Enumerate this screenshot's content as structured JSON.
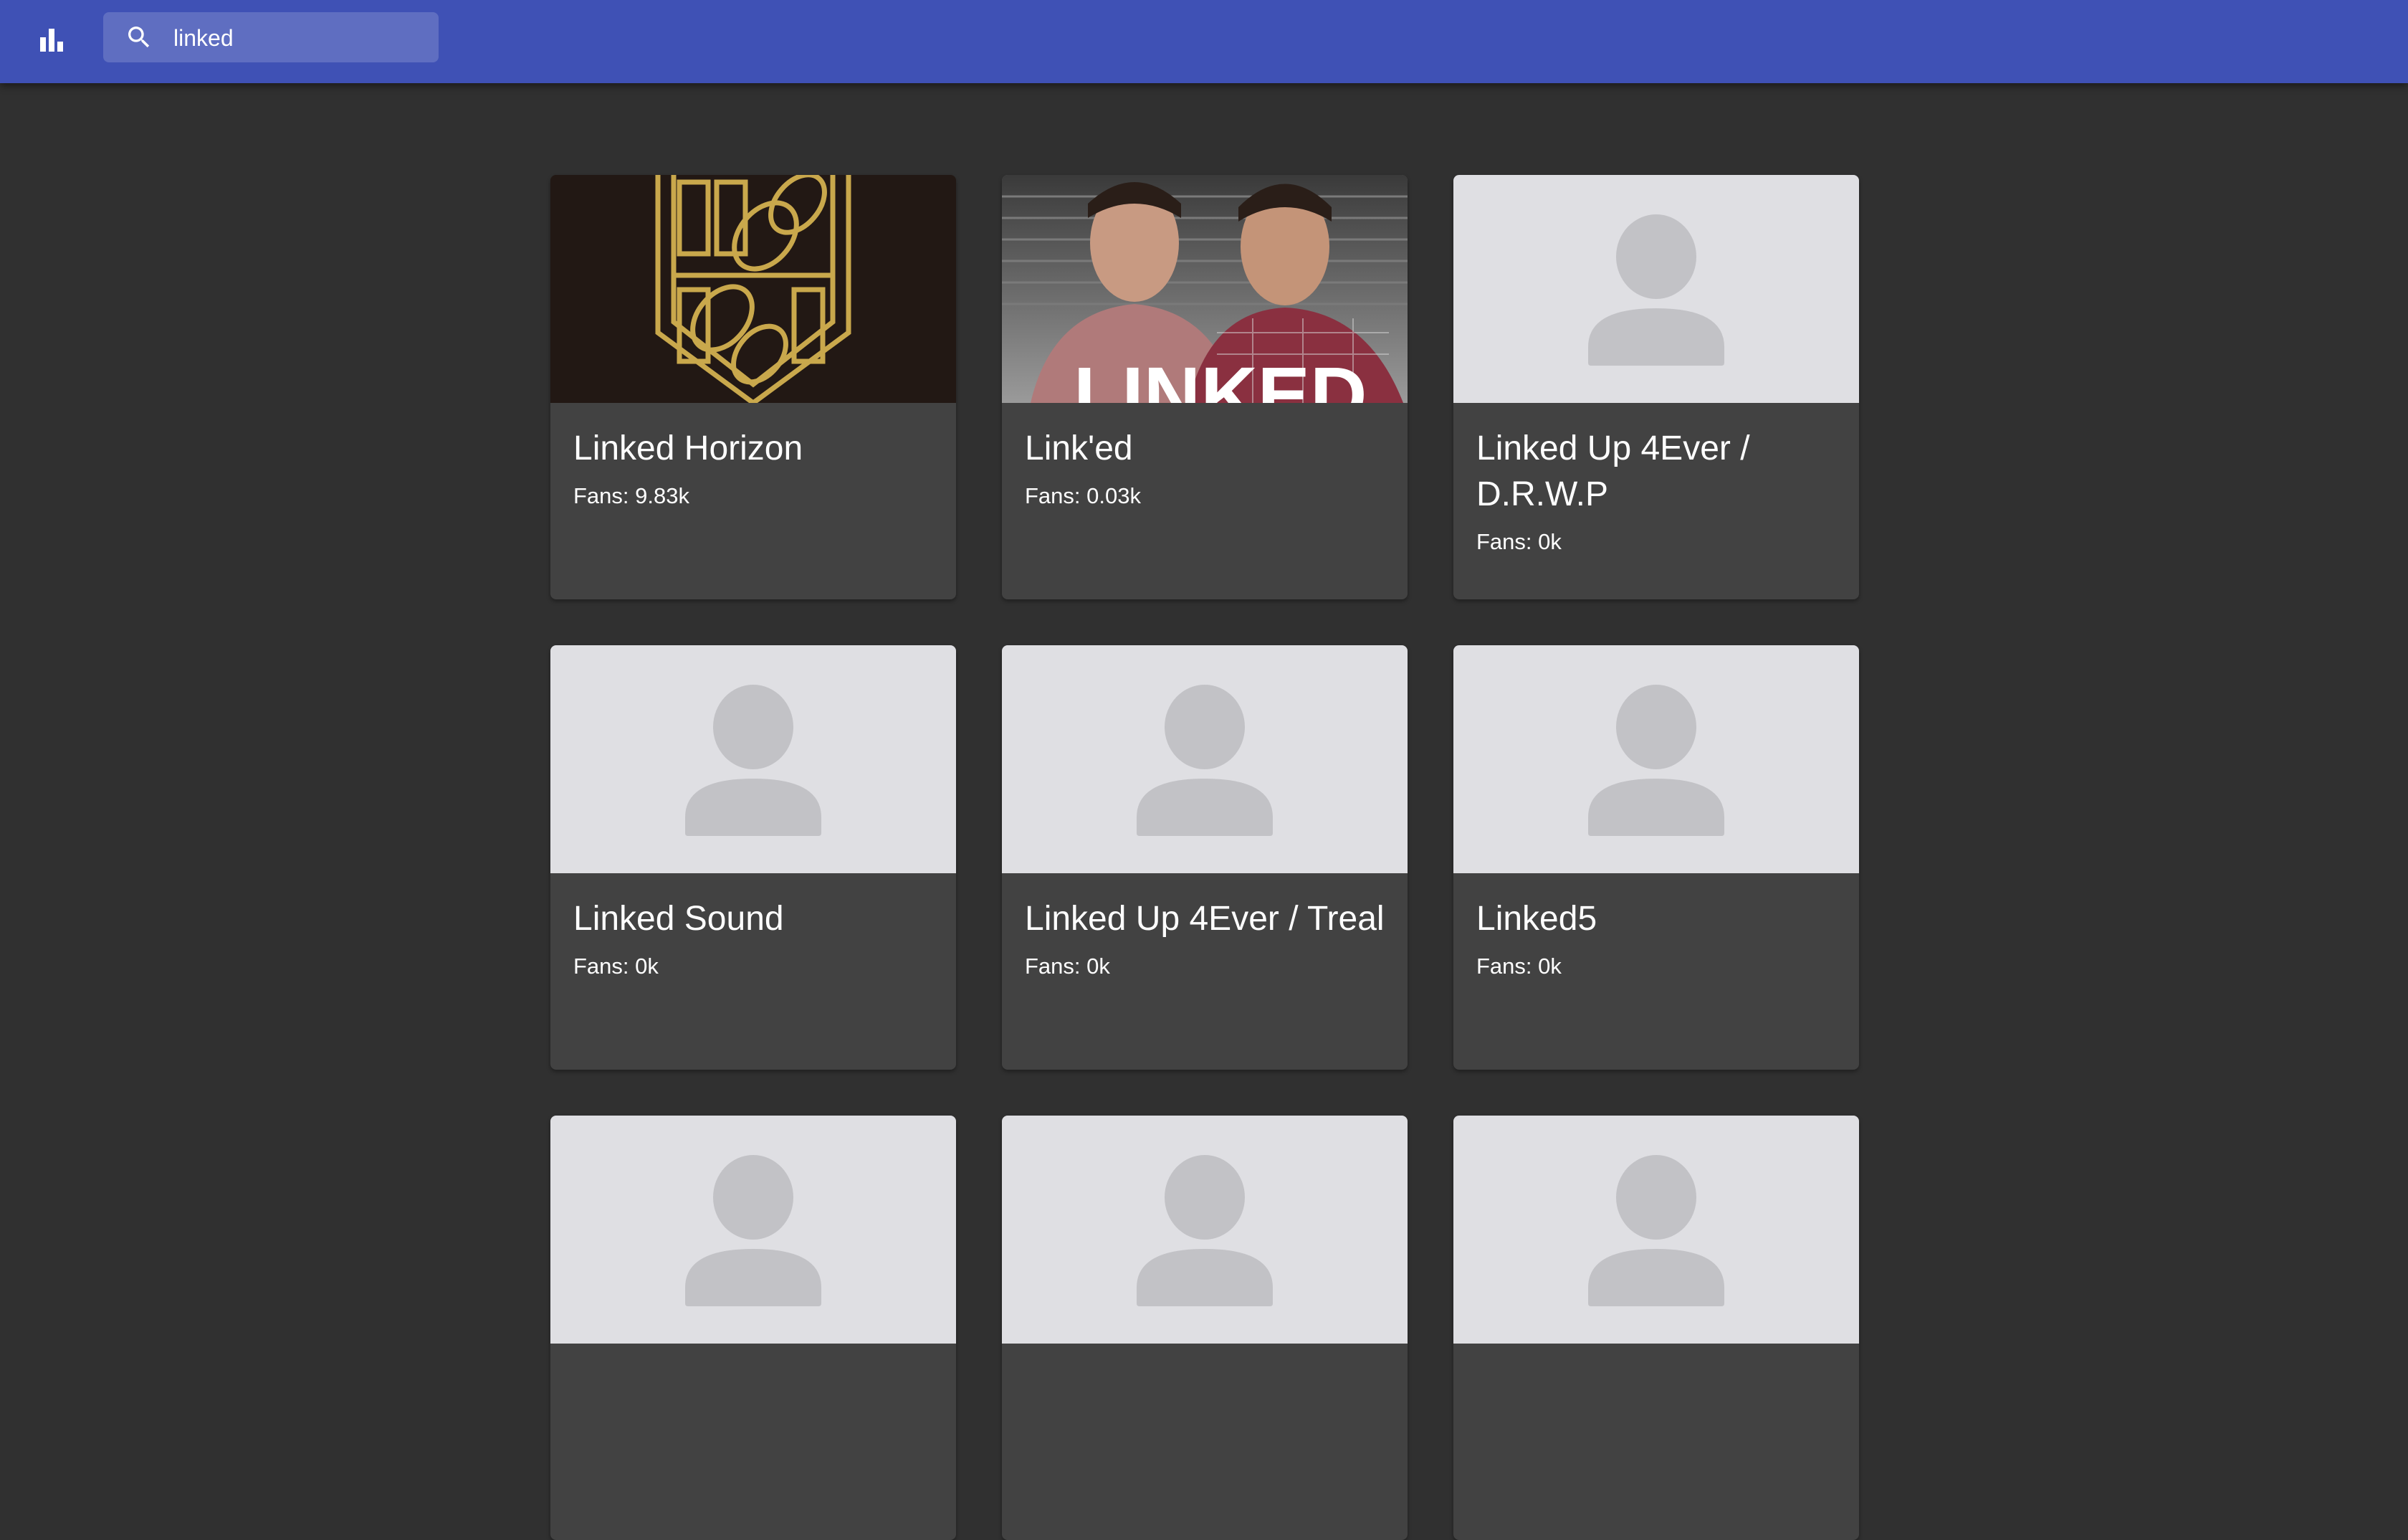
{
  "toolbar": {
    "logo_icon": "bar-chart-icon",
    "search": {
      "value": "linked",
      "placeholder": "Search",
      "icon": "search-icon"
    }
  },
  "colors": {
    "appbar": "#3f51b5",
    "background": "#303030",
    "card": "#424242",
    "placeholder_bg": "#dfdfe3",
    "placeholder_figure": "#c2c2c6"
  },
  "results": [
    {
      "title": "Linked Horizon",
      "fans": "Fans: 9.83k",
      "image": "logo"
    },
    {
      "title": "Link'ed",
      "fans": "Fans: 0.03k",
      "image": "photo"
    },
    {
      "title": "Linked Up 4Ever / D.R.W.P",
      "fans": "Fans: 0k",
      "image": "placeholder"
    },
    {
      "title": "Linked Sound",
      "fans": "Fans: 0k",
      "image": "placeholder"
    },
    {
      "title": "Linked Up 4Ever / Treal",
      "fans": "Fans: 0k",
      "image": "placeholder"
    },
    {
      "title": "Linked5",
      "fans": "Fans: 0k",
      "image": "placeholder"
    },
    {
      "title": "",
      "fans": "",
      "image": "placeholder"
    },
    {
      "title": "",
      "fans": "",
      "image": "placeholder"
    },
    {
      "title": "",
      "fans": "",
      "image": "placeholder"
    }
  ]
}
